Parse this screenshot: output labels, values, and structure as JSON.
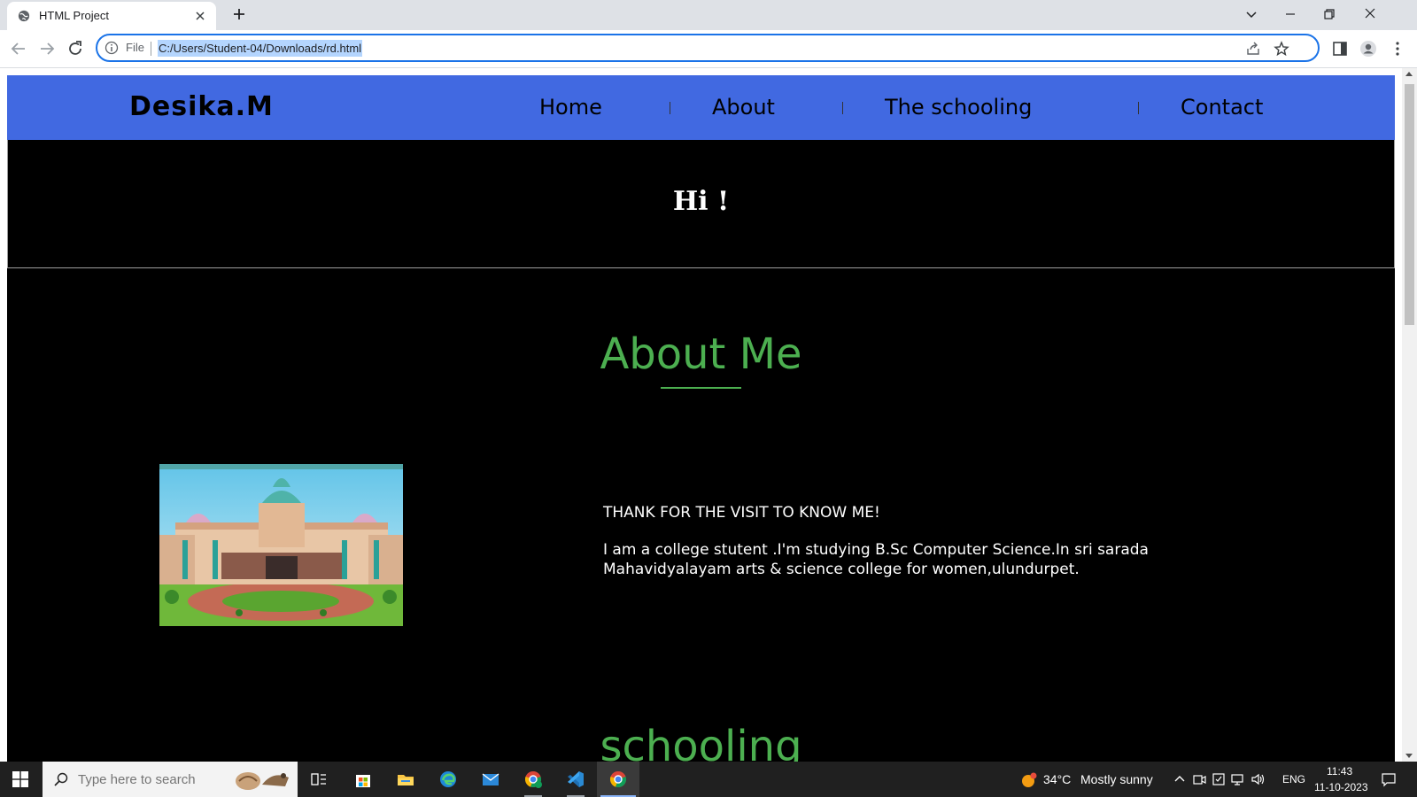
{
  "browser": {
    "tab_title": "HTML Project",
    "address_prefix": "File",
    "url": "C:/Users/Student-04/Downloads/rd.html"
  },
  "site": {
    "logo": "Desika.M",
    "nav": [
      "Home",
      "About",
      "The schooling",
      "Contact"
    ],
    "hero_text": "Hi !",
    "about_title": "About Me",
    "about_heading": "THANK FOR THE VISIT TO KNOW ME!",
    "about_body": "I am a college stutent .I'm studying B.Sc Computer Science.In sri sarada Mahavidyalayam arts & science college for women,ulundurpet.",
    "schooling_title": "schooling",
    "colors": {
      "nav_bg": "#4169e1",
      "title_green": "#4caf50",
      "page_bg": "#000000"
    }
  },
  "taskbar": {
    "search_placeholder": "Type here to search",
    "weather_temp": "34°C",
    "weather_desc": "Mostly sunny",
    "language": "ENG",
    "time": "11:43",
    "date": "11-10-2023",
    "apps": [
      "task-view-icon",
      "store-icon",
      "file-explorer-icon",
      "edge-icon",
      "mail-icon",
      "chrome-profile-icon",
      "vscode-icon",
      "chrome-icon"
    ]
  }
}
